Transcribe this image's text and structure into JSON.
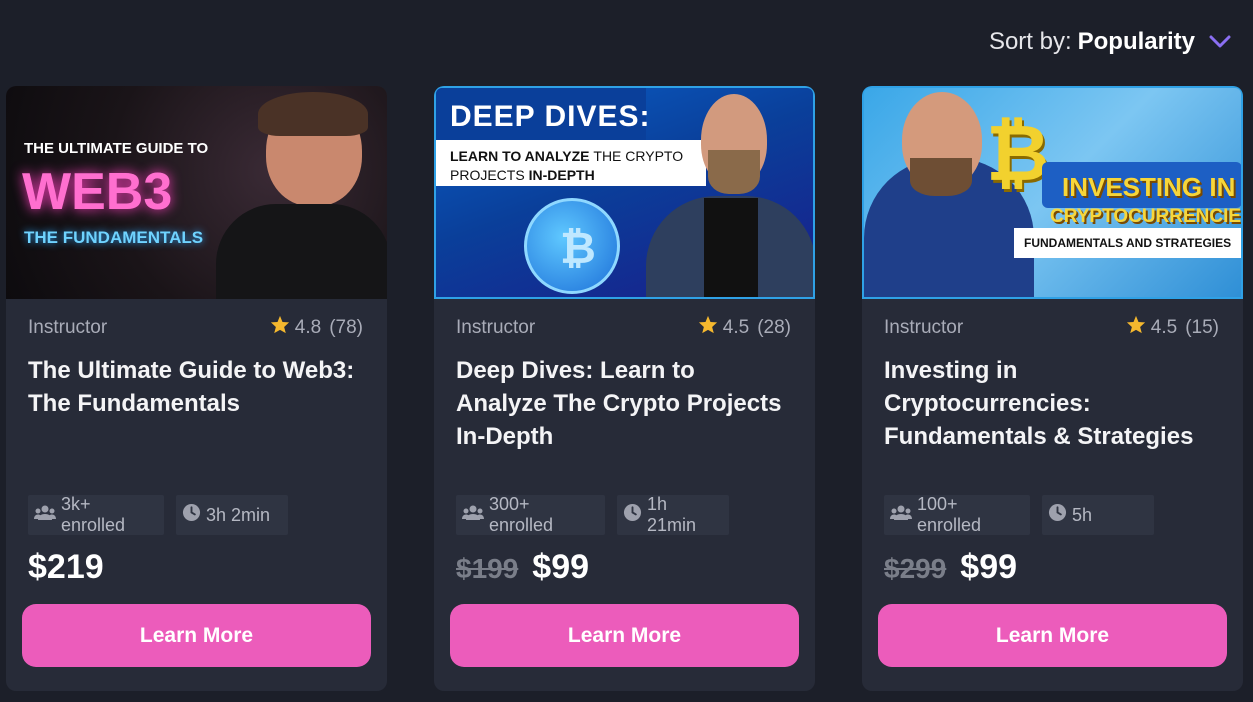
{
  "sort": {
    "label": "Sort by:",
    "value": "Popularity",
    "accent": "#8b6ff2"
  },
  "courses": [
    {
      "thumb": {
        "line1": "THE ULTIMATE GUIDE TO",
        "line2": "WEB3",
        "line3": "THE FUNDAMENTALS"
      },
      "instructor": "Instructor",
      "rating": "4.8",
      "reviews": "(78)",
      "title": "The Ultimate Guide to Web3: The Fundamentals",
      "enrolled": "3k+ enrolled",
      "duration": "3h 2min",
      "old_price": "",
      "price": "$219",
      "cta": "Learn More"
    },
    {
      "thumb": {
        "line1": "DEEP DIVES:",
        "line2a": "LEARN TO ANALYZE",
        "line2b": "THE CRYPTO",
        "line3a": "PROJECTS",
        "line3b": "IN-DEPTH"
      },
      "instructor": "Instructor",
      "rating": "4.5",
      "reviews": "(28)",
      "title": "Deep Dives: Learn to Analyze The Crypto Projects In-Depth",
      "enrolled": "300+ enrolled",
      "duration": "1h 21min",
      "old_price": "$199",
      "price": "$99",
      "cta": "Learn More"
    },
    {
      "thumb": {
        "line1": "INVESTING IN",
        "line2": "CRYPTOCURRENCIES:",
        "line3a": "FUNDAMENTALS",
        "line3b": "AND STRATEGIES"
      },
      "instructor": "Instructor",
      "rating": "4.5",
      "reviews": "(15)",
      "title": "Investing in Cryptocurrencies: Fundamentals & Strategies",
      "enrolled": "100+ enrolled",
      "duration": "5h",
      "old_price": "$299",
      "price": "$99",
      "cta": "Learn More"
    }
  ],
  "colors": {
    "background": "#1c1f29",
    "card": "#272b38",
    "chip": "#2f3442",
    "button": "#ec5cbb",
    "star": "#f5b82e"
  }
}
